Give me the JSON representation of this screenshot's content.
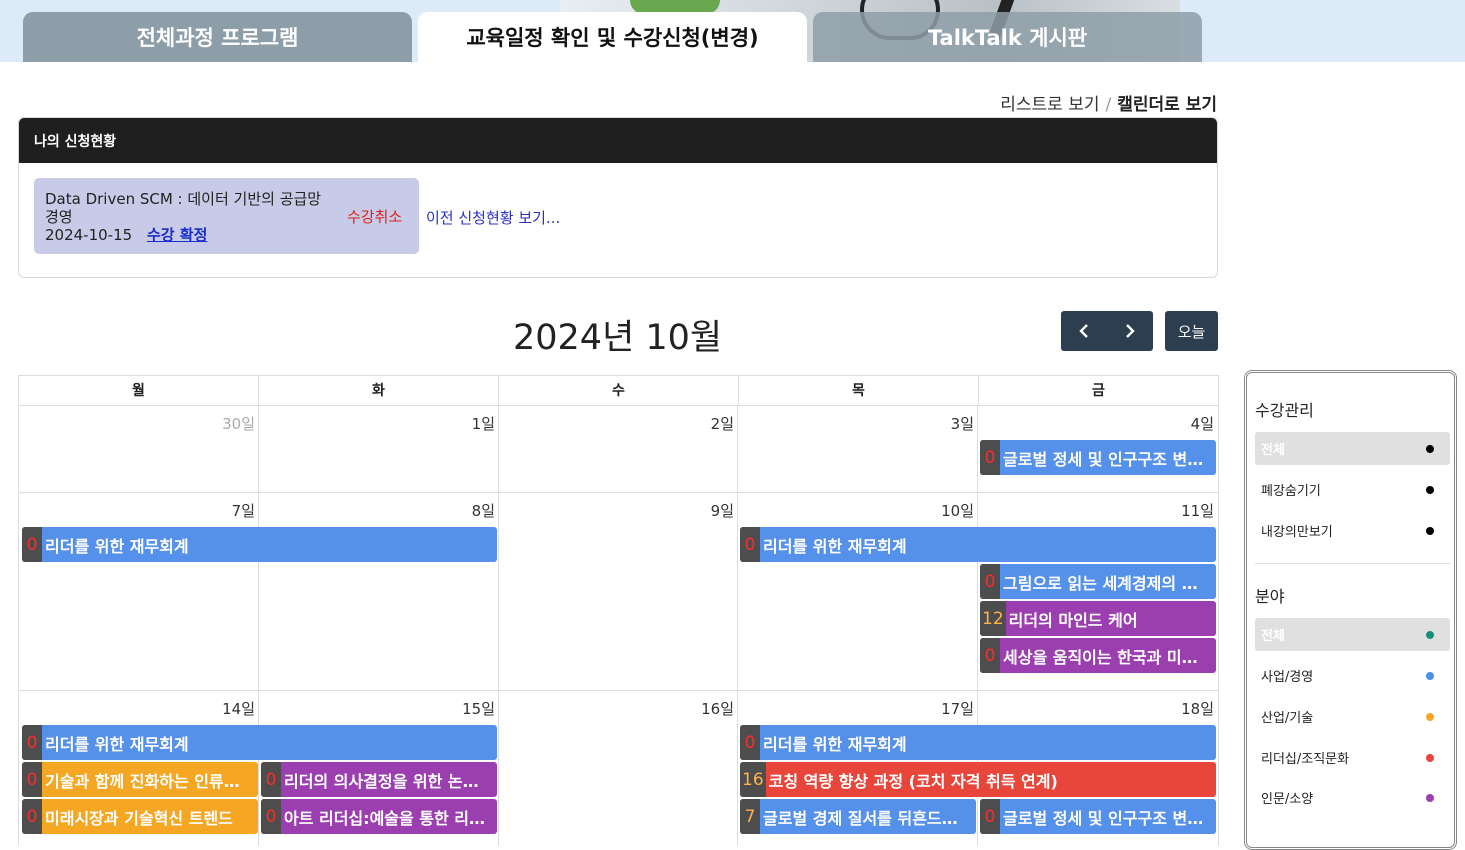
{
  "tabs": [
    "전체과정 프로그램",
    "교육일정 확인 및 수강신청(변경)",
    "TalkTalk 게시판"
  ],
  "view_toggle": {
    "list": "리스트로 보기",
    "separator": "/",
    "calendar": "캘린더로 보기"
  },
  "my_status": {
    "header": "나의 신청현황",
    "course_line1": "Data Driven SCM : 데이터 기반의 공급망",
    "course_line2": "경영",
    "date": "2024-10-15",
    "confirm": "수강 확정",
    "cancel": "수강취소",
    "previous_link": "이전 신청현황 보기..."
  },
  "calendar": {
    "title": "2024년 10월",
    "prev_icon": "chevron-left-icon",
    "next_icon": "chevron-right-icon",
    "today_label": "오늘",
    "weekdays": [
      "월",
      "화",
      "수",
      "목",
      "금"
    ],
    "week1": [
      "30일",
      "1일",
      "2일",
      "3일",
      "4일"
    ],
    "week2": [
      "7일",
      "8일",
      "9일",
      "10일",
      "11일"
    ],
    "week3": [
      "14일",
      "15일",
      "16일",
      "17일",
      "18일"
    ],
    "events": {
      "e1": {
        "count": "0",
        "title": "글로벌 정세 및 인구구조 변화…",
        "color": "#5590ea"
      },
      "e2": {
        "count": "0",
        "title": "리더를 위한 재무회계",
        "color": "#5590ea"
      },
      "e3": {
        "count": "0",
        "title": "리더를 위한 재무회계",
        "color": "#5590ea"
      },
      "e4": {
        "count": "0",
        "title": "그림으로 읽는 세계경제의 변…",
        "color": "#5590ea"
      },
      "e5": {
        "count": "12",
        "title": "리더의 마인드 케어",
        "color": "#9b3fb0"
      },
      "e6": {
        "count": "0",
        "title": "세상을 움직이는 한국과 미국…",
        "color": "#9b3fb0"
      },
      "e7": {
        "count": "0",
        "title": "리더를 위한 재무회계",
        "color": "#5590ea"
      },
      "e8": {
        "count": "0",
        "title": "리더를 위한 재무회계",
        "color": "#5590ea"
      },
      "e9": {
        "count": "0",
        "title": "기술과 함께 진화하는 인류의 …",
        "color": "#f5a623"
      },
      "e10": {
        "count": "0",
        "title": "리더의 의사결정을 위한 논리…",
        "color": "#9b3fb0"
      },
      "e11": {
        "count": "16",
        "title": "코칭 역량 향상 과정 (코치 자격 취득 연계)",
        "color": "#e8463a"
      },
      "e12": {
        "count": "0",
        "title": "미래시장과 기술혁신 트렌드",
        "color": "#f5a623"
      },
      "e13": {
        "count": "0",
        "title": "아트 리더십:예술을 통한 리더…",
        "color": "#9b3fb0"
      },
      "e14": {
        "count": "7",
        "title": "글로벌 경제 질서를 뒤흔드는 …",
        "color": "#5590ea"
      },
      "e15": {
        "count": "0",
        "title": "글로벌 정세 및 인구구조 변화…",
        "color": "#5590ea"
      }
    }
  },
  "sidebar": {
    "section1_title": "수강관리",
    "section1_items": [
      {
        "label": "전체",
        "color": "#000000"
      },
      {
        "label": "폐강숨기기",
        "color": "#000000"
      },
      {
        "label": "내강의만보기",
        "color": "#000000"
      }
    ],
    "section2_title": "분야",
    "section2_items": [
      {
        "label": "전체",
        "color": "#1a8c7a"
      },
      {
        "label": "사업/경영",
        "color": "#4a8fe7"
      },
      {
        "label": "산업/기술",
        "color": "#f5a623"
      },
      {
        "label": "리더십/조직문화",
        "color": "#e8463a"
      },
      {
        "label": "인문/소양",
        "color": "#9b3fb0"
      }
    ]
  }
}
